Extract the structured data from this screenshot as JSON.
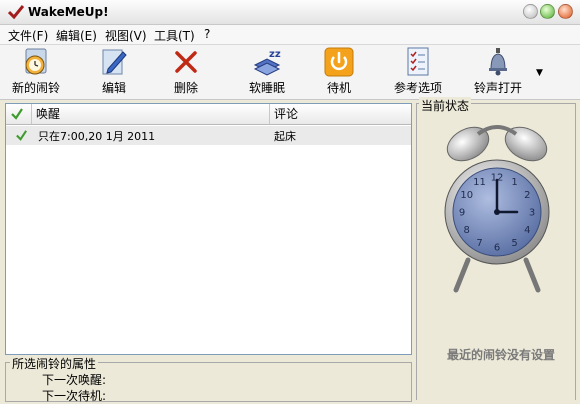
{
  "window": {
    "title": "WakeMeUp!"
  },
  "menu": [
    {
      "label": "文件(F)"
    },
    {
      "label": "编辑(E)"
    },
    {
      "label": "视图(V)"
    },
    {
      "label": "工具(T)"
    },
    {
      "label": "?"
    }
  ],
  "toolbar": [
    {
      "label": "新的闹铃",
      "icon": "new-alarm-icon"
    },
    {
      "label": "编辑",
      "icon": "edit-pencil-icon"
    },
    {
      "label": "删除",
      "icon": "delete-x-icon"
    },
    {
      "label": "软睡眠",
      "icon": "soft-sleep-icon"
    },
    {
      "label": "待机",
      "icon": "power-icon"
    },
    {
      "label": "参考选项",
      "icon": "options-checklist-icon"
    },
    {
      "label": "铃声打开",
      "icon": "bell-icon"
    }
  ],
  "list": {
    "columns": {
      "wake": "唤醒",
      "comment": "评论"
    },
    "rows": [
      {
        "wake": "只在7:00,20 1月 2011",
        "comment": "起床",
        "checked": true
      }
    ]
  },
  "properties": {
    "title": "所选闹铃的属性",
    "next_wake_label": "下一次唤醒:",
    "next_standby_label": "下一次待机:"
  },
  "status": {
    "title": "当前状态",
    "message": "最近的闹铃没有设置",
    "clock_numerals": [
      "12",
      "1",
      "2",
      "3",
      "4",
      "5",
      "6",
      "7",
      "8",
      "9",
      "10",
      "11"
    ]
  },
  "colors": {
    "accent_green": "#3e9c2e",
    "clock_face": "#6f86b7",
    "standby_orange": "#f4a21c"
  }
}
